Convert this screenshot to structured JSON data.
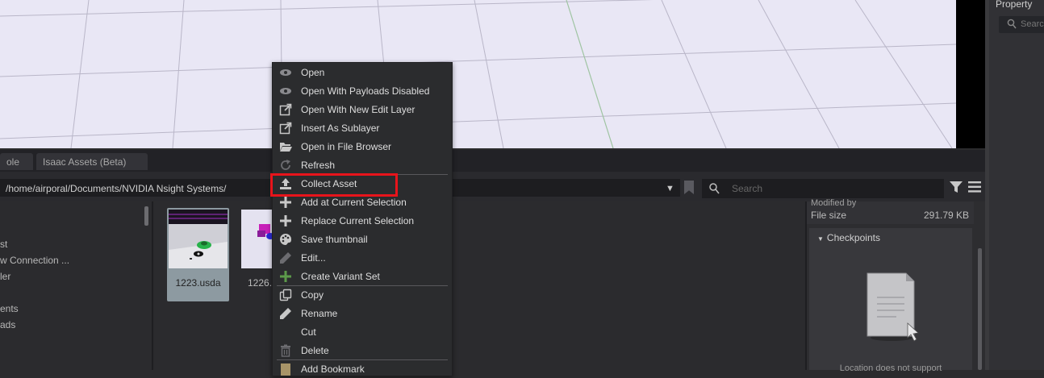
{
  "viewport": {
    "background": "#e9e7f5",
    "grid_color": "#b9b6c8"
  },
  "property_panel": {
    "title": "Property",
    "search_placeholder": "Search"
  },
  "tabs": [
    {
      "label": "ole"
    },
    {
      "label": "Isaac Assets (Beta)"
    }
  ],
  "pathbar": {
    "path": "/home/airporal/Documents/NVIDIA Nsight Systems/",
    "search_placeholder": "Search"
  },
  "tree_items": [
    {
      "label": "st"
    },
    {
      "label": "w Connection ..."
    },
    {
      "label": "ler"
    },
    {
      "label": "ents"
    },
    {
      "label": "ads"
    }
  ],
  "files": [
    {
      "name": "1223.usda",
      "selected": true
    },
    {
      "name": "1226.",
      "selected": false
    }
  ],
  "details": {
    "modified_label": "Modified by",
    "file_size_label": "File size",
    "file_size_value": "291.79 KB",
    "checkpoints_title": "Checkpoints",
    "checkpoints_note": "Location does not support"
  },
  "context_menu": {
    "items": [
      {
        "label": "Open",
        "icon": "eye-icon"
      },
      {
        "label": "Open With Payloads Disabled",
        "icon": "eye-icon"
      },
      {
        "label": "Open With New Edit Layer",
        "icon": "external-link-icon"
      },
      {
        "label": "Insert As Sublayer",
        "icon": "external-link-icon"
      },
      {
        "label": "Open in File Browser",
        "icon": "folder-open-icon"
      },
      {
        "label": "Refresh",
        "icon": "refresh-icon"
      },
      {
        "label": "Collect Asset",
        "icon": "upload-icon"
      },
      {
        "label": "Add at Current Selection",
        "icon": "plus-icon"
      },
      {
        "label": "Replace Current Selection",
        "icon": "plus-icon"
      },
      {
        "label": "Save thumbnail",
        "icon": "palette-icon"
      },
      {
        "label": "Edit...",
        "icon": "pencil-icon"
      },
      {
        "label": "Create Variant Set",
        "icon": "plus-icon"
      },
      {
        "label": "Copy",
        "icon": "copy-icon"
      },
      {
        "label": "Rename",
        "icon": "pencil-icon"
      },
      {
        "label": "Cut",
        "icon": "cut-icon"
      },
      {
        "label": "Delete",
        "icon": "trash-icon"
      },
      {
        "label": "Add Bookmark",
        "icon": "bookmark-icon"
      }
    ],
    "highlighted_item": "Collect Asset",
    "highlight_color": "#e8141b"
  }
}
